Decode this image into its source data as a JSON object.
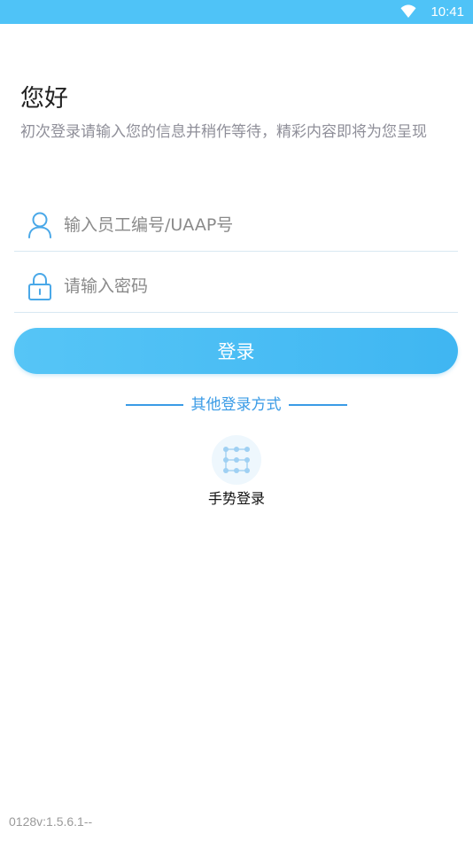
{
  "status_bar": {
    "time": "10:41",
    "wifi_icon": "wifi-icon",
    "background": "#4fc3f7"
  },
  "greeting": {
    "title": "您好",
    "subtitle": "初次登录请输入您的信息并稍作等待，精彩内容即将为您呈现"
  },
  "form": {
    "username": {
      "icon": "user-icon",
      "placeholder": "输入员工编号/UAAP号",
      "value": ""
    },
    "password": {
      "icon": "lock-icon",
      "placeholder": "请输入密码",
      "value": ""
    },
    "login_label": "登录"
  },
  "other_login": {
    "divider_label": "其他登录方式",
    "gesture": {
      "icon": "gesture-pattern-icon",
      "label": "手势登录"
    }
  },
  "version": "0128v:1.5.6.1--",
  "colors": {
    "accent": "#3a9be6",
    "button_start": "#56c5f6",
    "button_end": "#3fb6f2"
  }
}
